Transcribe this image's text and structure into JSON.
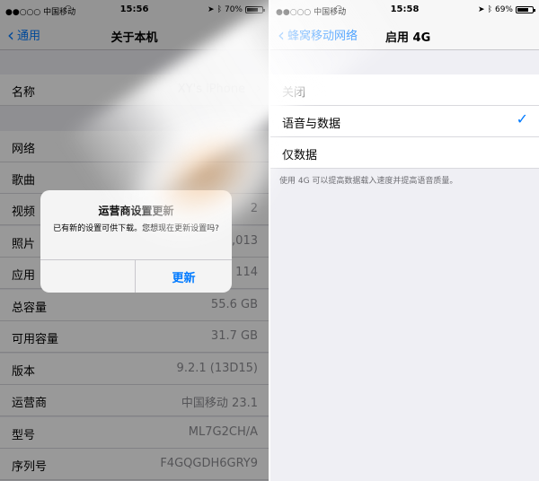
{
  "left": {
    "status": {
      "carrier": "●●○○○ 中国移动",
      "time": "15:56",
      "battery": "70%"
    },
    "nav": {
      "back": "通用",
      "title": "关于本机"
    },
    "rows": [
      {
        "label": "名称",
        "value": "XY's iPhone"
      },
      {
        "label": "网络",
        "value": ""
      },
      {
        "label": "歌曲",
        "value": ""
      },
      {
        "label": "视频",
        "value": "2"
      },
      {
        "label": "照片",
        "value": "4,013"
      },
      {
        "label": "应用",
        "value": "114"
      },
      {
        "label": "总容量",
        "value": "55.6 GB"
      },
      {
        "label": "可用容量",
        "value": "31.7 GB"
      },
      {
        "label": "版本",
        "value": "9.2.1 (13D15)"
      },
      {
        "label": "运营商",
        "value": "中国移动 23.1"
      },
      {
        "label": "型号",
        "value": "ML7G2CH/A"
      },
      {
        "label": "序列号",
        "value": "F4GQGDH6GRY9"
      }
    ],
    "alert": {
      "title": "运营商设置更新",
      "message": "已有新的设置可供下载。您想现在更新设置吗?",
      "later": "",
      "update": "更新"
    }
  },
  "right": {
    "status": {
      "carrier": "●●○○○ 中国移动",
      "time": "15:58",
      "battery": "69%"
    },
    "nav": {
      "back": "蜂窝移动网络",
      "title": "启用 4G"
    },
    "options": [
      {
        "label": "关闭",
        "selected": false
      },
      {
        "label": "语音与数据",
        "selected": true
      },
      {
        "label": "仅数据",
        "selected": false
      }
    ],
    "footnote": "使用 4G 可以提高数据载入速度并提高语音质量。"
  },
  "colors": {
    "accent": "#007aff",
    "background": "#efeff4",
    "separator": "#c8c7cc"
  },
  "icons": {
    "wifi": "wifi-icon",
    "location": "location-icon",
    "bluetooth": "bluetooth-icon",
    "battery": "battery-icon",
    "back": "chevron-left-icon",
    "checkmark": "checkmark-icon"
  }
}
